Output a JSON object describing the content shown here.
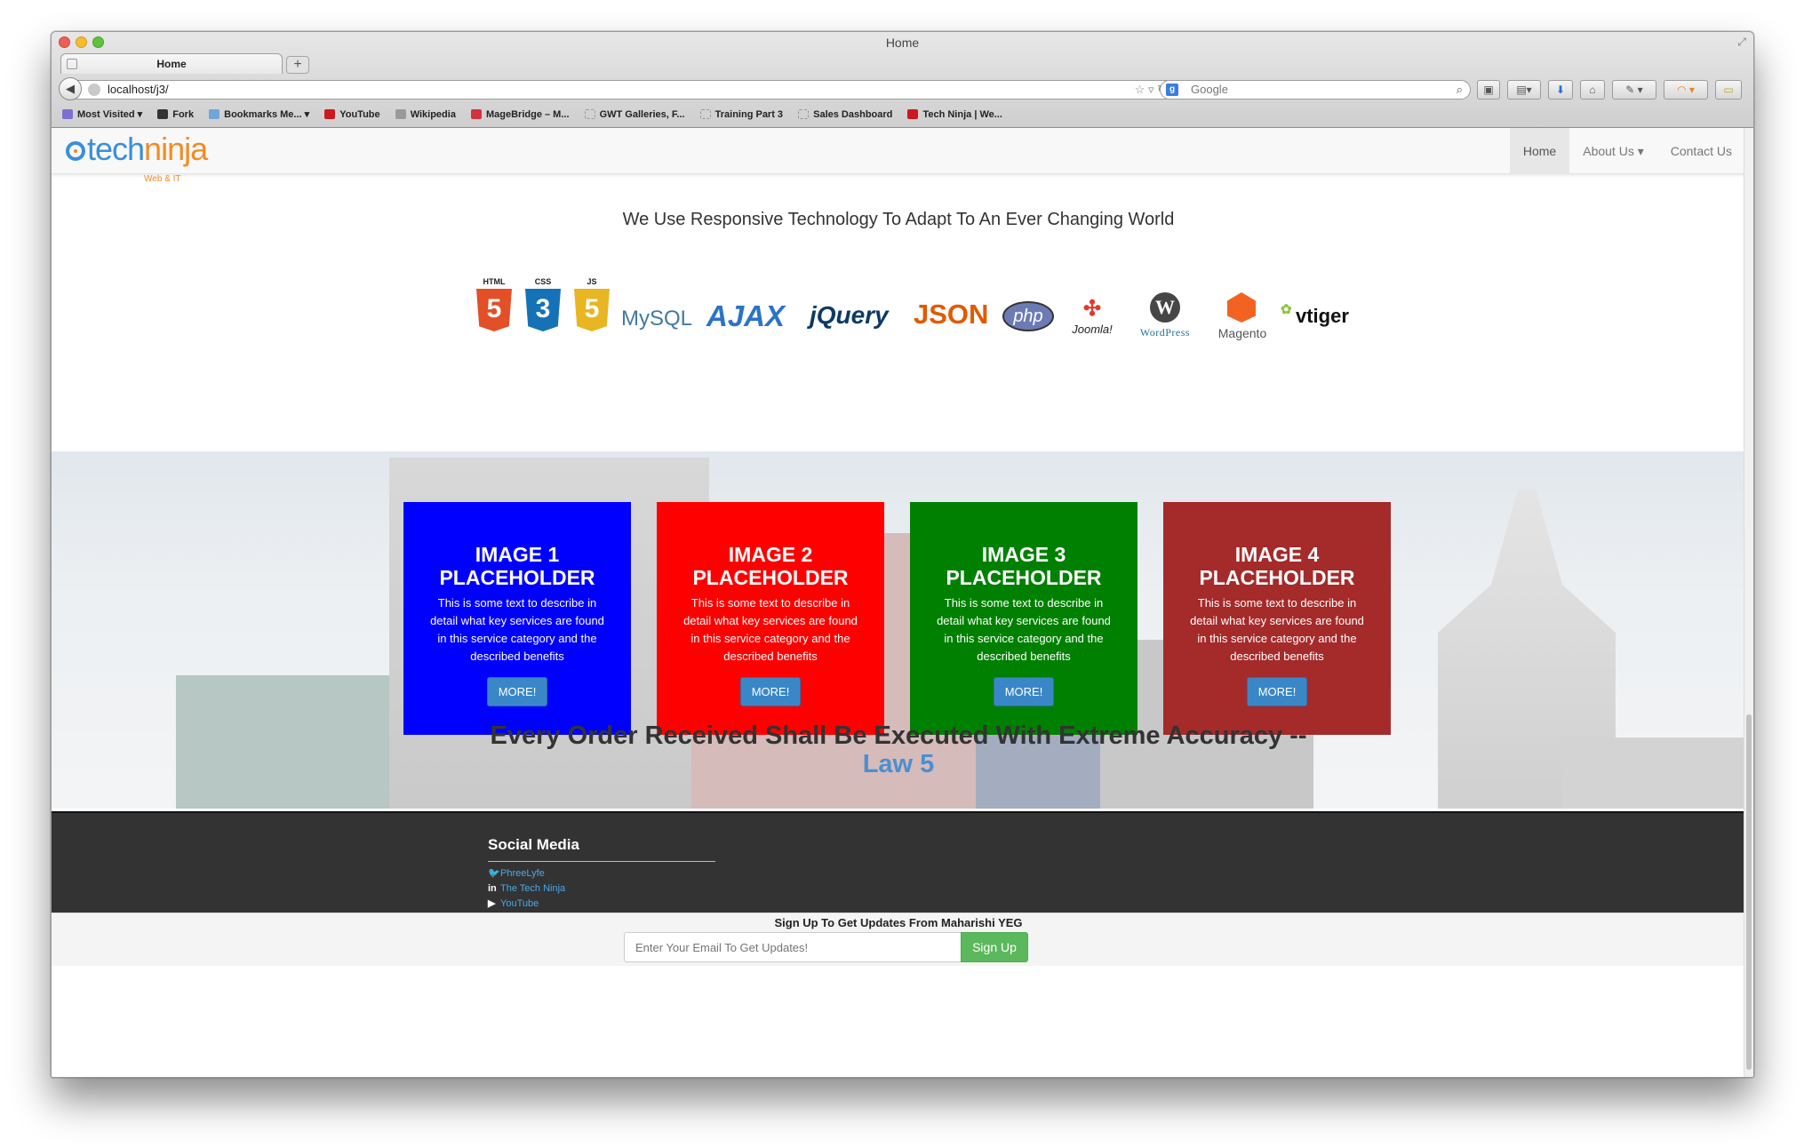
{
  "browser": {
    "window_title": "Home",
    "tab_label": "Home",
    "new_tab": "+",
    "url": "localhost/j3/",
    "search_engine_letter": "g",
    "search_placeholder": "Google",
    "bookmarks": [
      {
        "label": "Most Visited",
        "icon_color": "#7b6fd0"
      },
      {
        "label": "Fork",
        "icon_color": "#333333"
      },
      {
        "label": "Bookmarks Me...",
        "icon_color": "#6ea6d9"
      },
      {
        "label": "YouTube",
        "icon_color": "#cc181e"
      },
      {
        "label": "Wikipedia",
        "icon_color": "#999999"
      },
      {
        "label": "MageBridge – M...",
        "icon_color": "#d0343a"
      },
      {
        "label": "GWT Galleries, F...",
        "icon_color": "#bbbbbb"
      },
      {
        "label": "Training Part 3",
        "icon_color": "#bbbbbb"
      },
      {
        "label": "Sales Dashboard",
        "icon_color": "#bbbbbb"
      },
      {
        "label": "Tech Ninja | We...",
        "icon_color": "#cc181e"
      }
    ]
  },
  "site": {
    "logo": {
      "part1": "tech",
      "part2": "ninja",
      "sub": "Web & IT"
    },
    "nav": [
      {
        "label": "Home",
        "active": true
      },
      {
        "label": "About Us ▾",
        "active": false
      },
      {
        "label": "Contact Us",
        "active": false
      }
    ],
    "tagline": "We Use Responsive Technology To Adapt To An Ever Changing World",
    "tech_logos": [
      {
        "name": "HTML5",
        "label": "HTML",
        "glyph": "5",
        "color": "#e34f26"
      },
      {
        "name": "CSS3",
        "label": "CSS",
        "glyph": "3",
        "color": "#1572b6"
      },
      {
        "name": "JS",
        "label": "JS",
        "glyph": "5",
        "color": "#e8b623"
      },
      {
        "name": "MySQL",
        "text": "MySQL"
      },
      {
        "name": "AJAX",
        "text": "AJAX"
      },
      {
        "name": "jQuery",
        "text": "jQuery"
      },
      {
        "name": "JSON",
        "text": "JSON"
      },
      {
        "name": "php",
        "text": "php"
      },
      {
        "name": "Joomla",
        "text": "Joomla!"
      },
      {
        "name": "WordPress",
        "text": "WordPress"
      },
      {
        "name": "Magento",
        "text": "Magento"
      },
      {
        "name": "vtiger",
        "text": "vtiger"
      }
    ],
    "cards": [
      {
        "title": "IMAGE 1 PLACEHOLDER",
        "text": "This is some text to describe in detail what key services are found in this service category and the described benefits",
        "button": "MORE!",
        "color": "#0000ff"
      },
      {
        "title": "IMAGE 2 PLACEHOLDER",
        "text": "This is some text to describe in detail what key services are found in this service category and the described benefits",
        "button": "MORE!",
        "color": "#ff0000"
      },
      {
        "title": "IMAGE 3 PLACEHOLDER",
        "text": "This is some text to describe in detail what key services are found in this service category and the described benefits",
        "button": "MORE!",
        "color": "#008000"
      },
      {
        "title": "IMAGE 4 PLACEHOLDER",
        "text": "This is some text to describe in detail what key services are found in this service category and the described benefits",
        "button": "MORE!",
        "color": "#a52a2a"
      }
    ],
    "quote": {
      "text": "Every Order Received Shall Be Executed With Extreme Accuracy --",
      "law": "Law 5"
    },
    "footer": {
      "social_title": "Social Media",
      "links": [
        {
          "icon": "twitter-icon",
          "glyph": "🐦",
          "label": "PhreeLyfe"
        },
        {
          "icon": "linkedin-icon",
          "glyph": "in",
          "label": "The Tech Ninja"
        },
        {
          "icon": "youtube-icon",
          "glyph": "▶",
          "label": "YouTube"
        }
      ]
    },
    "signup": {
      "title": "Sign Up To Get Updates From Maharishi YEG",
      "placeholder": "Enter Your Email To Get Updates!",
      "button": "Sign Up"
    }
  }
}
